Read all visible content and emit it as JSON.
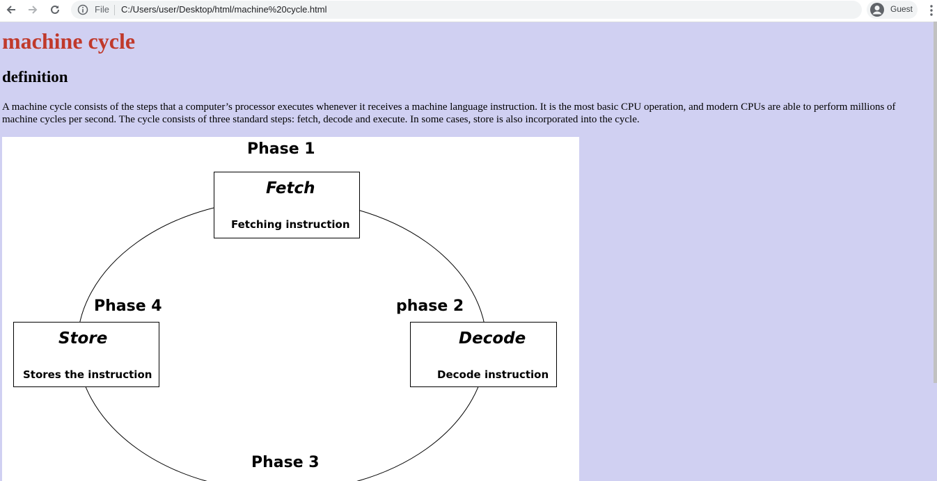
{
  "browser": {
    "scheme_label": "File",
    "url": "C:/Users/user/Desktop/html/machine%20cycle.html",
    "profile_label": "Guest"
  },
  "page": {
    "title": "machine cycle",
    "title_color": "#c0392b",
    "background_color": "#d0d0f2",
    "section_heading": "definition",
    "definition_text": "A machine cycle consists of the steps that a computer’s processor executes whenever it receives a machine language instruction. It is the most basic CPU operation, and modern CPUs are able to perform millions of machine cycles per second. The cycle consists of three standard steps: fetch, decode and execute. In some cases, store is also incorporated into the cycle."
  },
  "diagram": {
    "phases": {
      "phase1": "Phase 1",
      "phase2": "phase 2",
      "phase3": "Phase 3",
      "phase4": "Phase 4"
    },
    "fetch": {
      "title": "Fetch",
      "description": "Fetching instruction"
    },
    "decode": {
      "title": "Decode",
      "description": "Decode instruction"
    },
    "store": {
      "title": "Store",
      "description": "Stores the instruction"
    }
  }
}
